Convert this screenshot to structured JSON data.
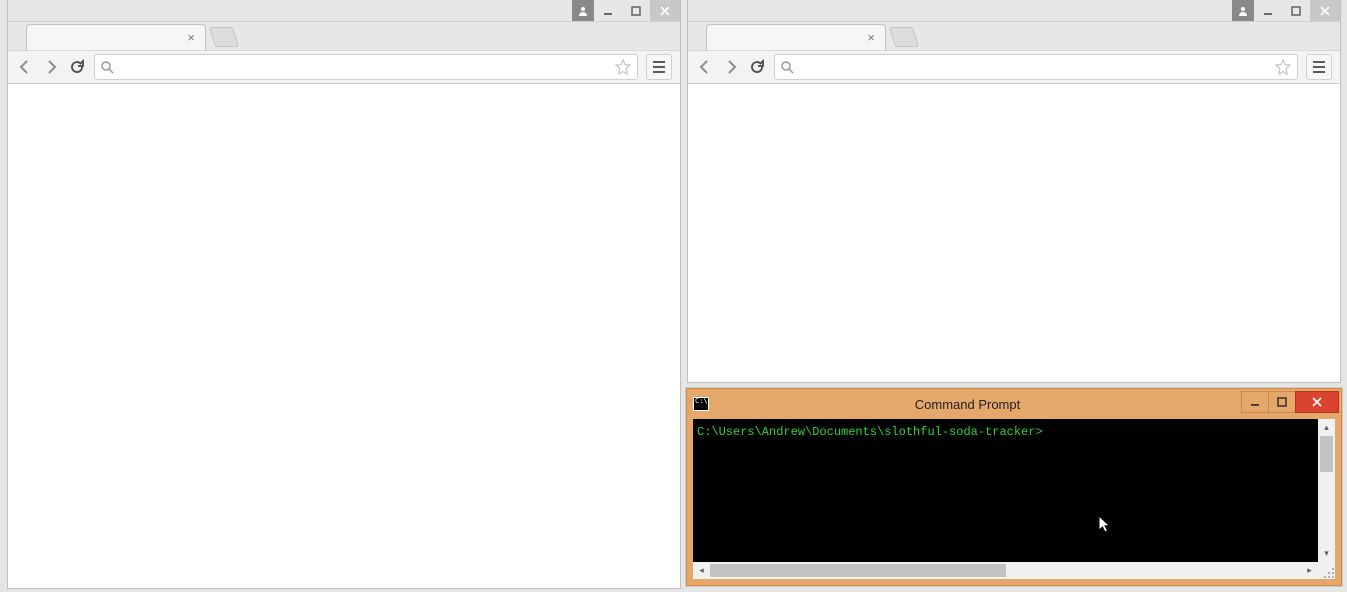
{
  "browser_left": {
    "tab_title": "",
    "address_value": ""
  },
  "browser_right": {
    "tab_title": "",
    "address_value": ""
  },
  "cmd": {
    "title": "Command Prompt",
    "prompt_line": "C:\\Users\\Andrew\\Documents\\slothful-soda-tracker>"
  }
}
